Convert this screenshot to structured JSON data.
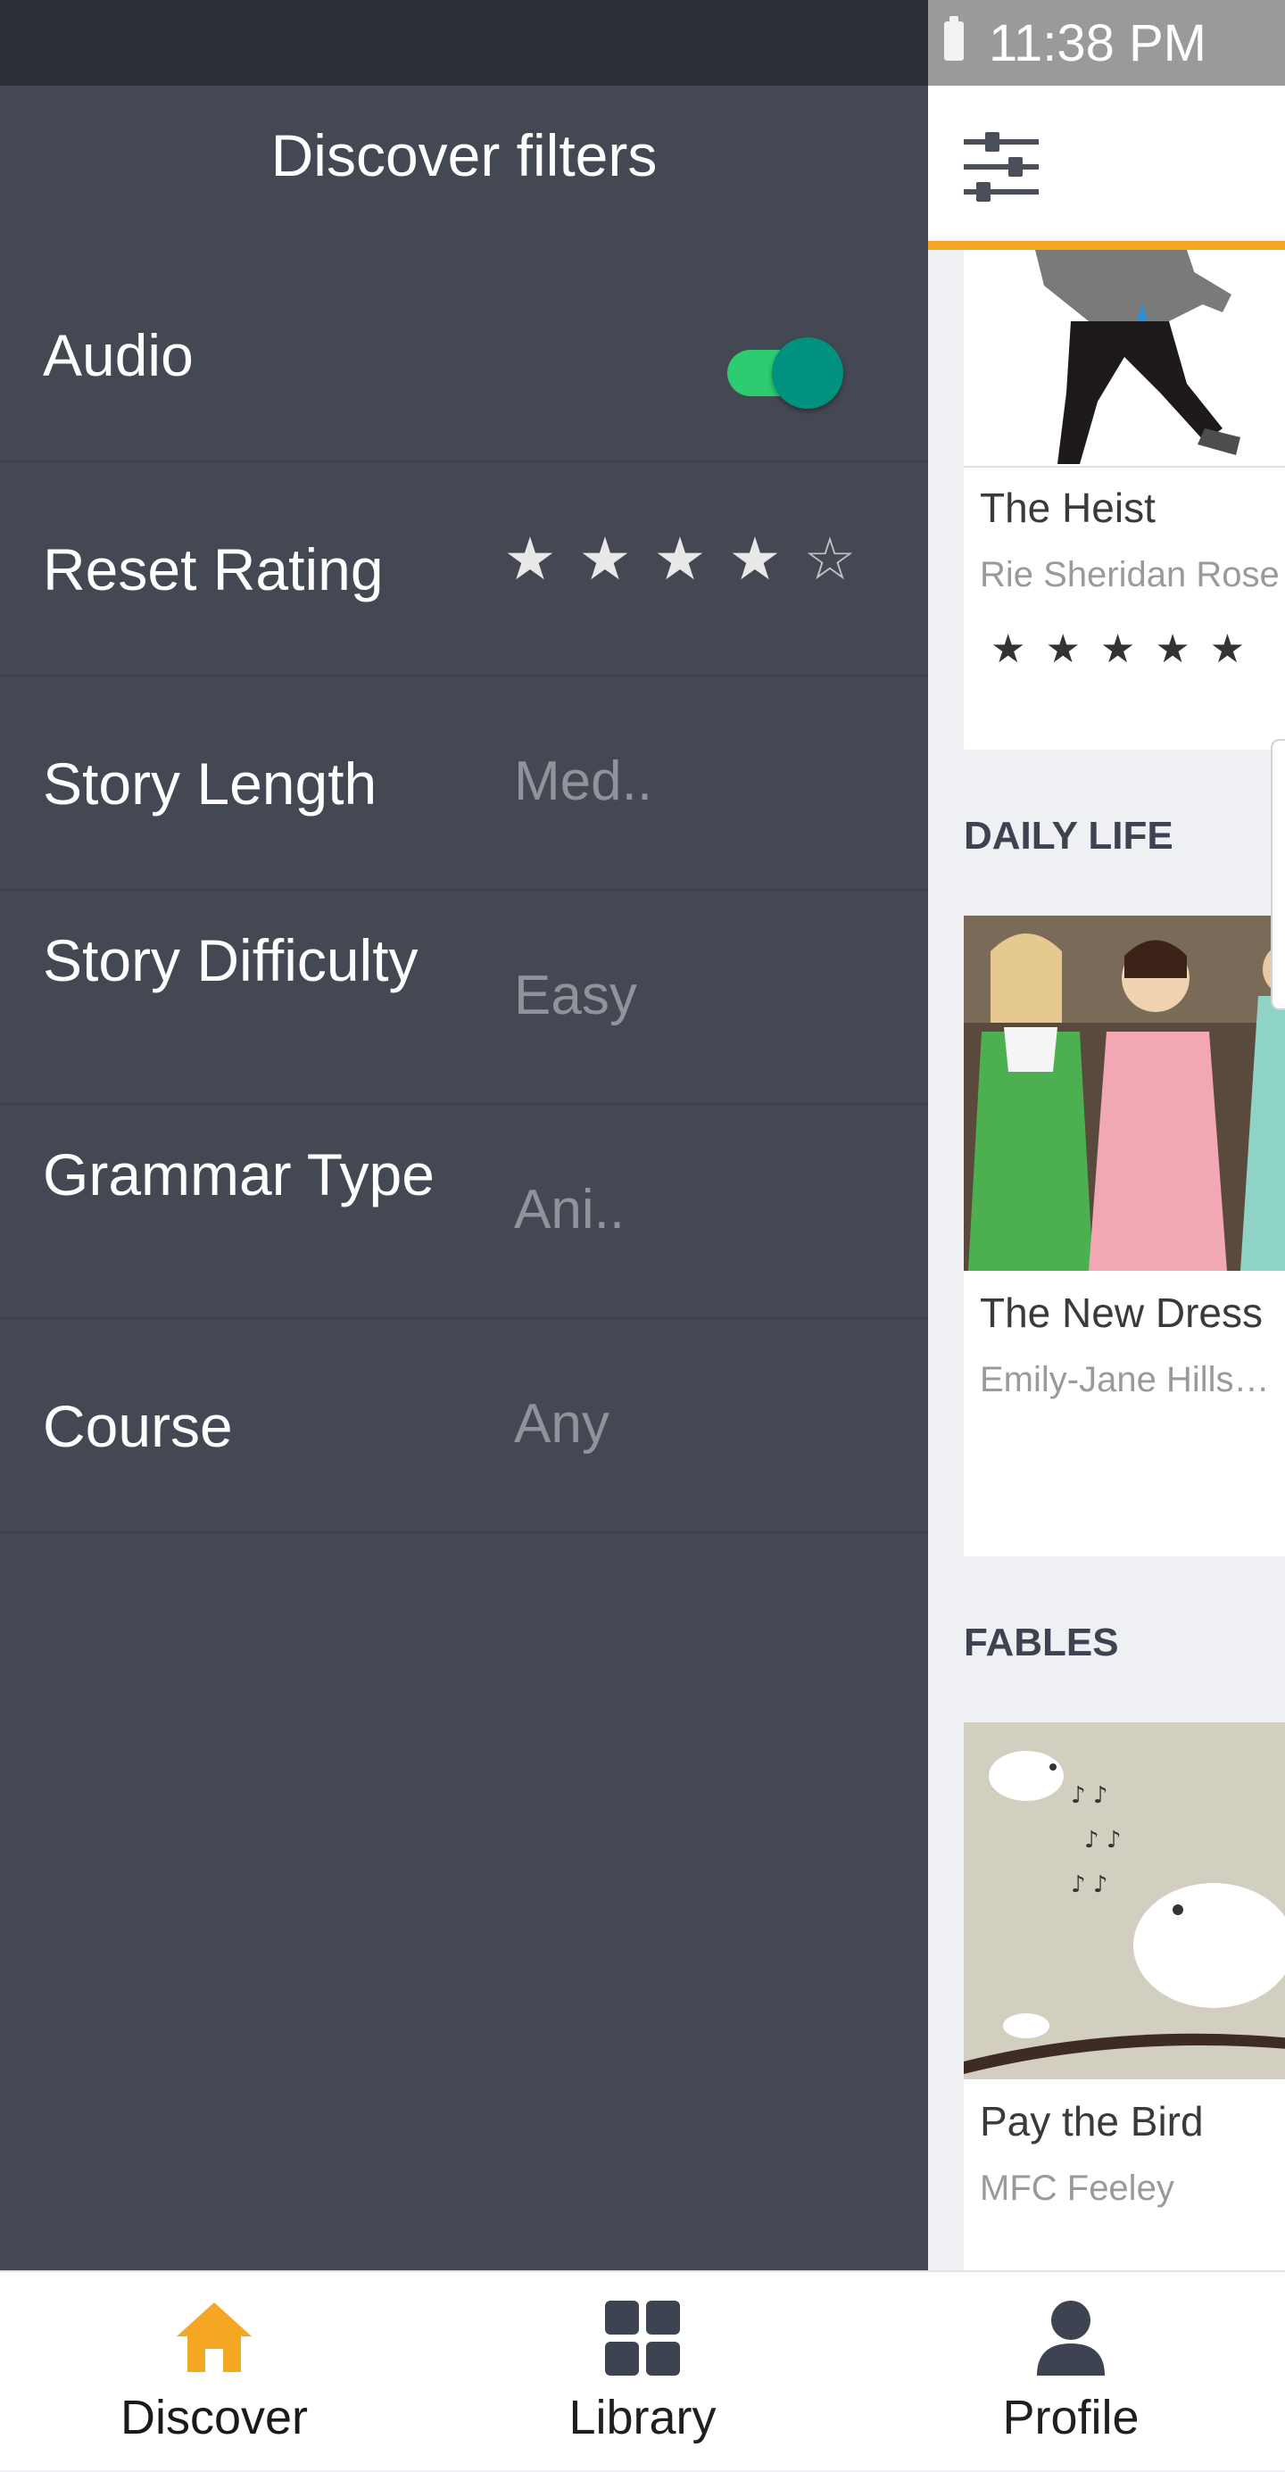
{
  "status_bar": {
    "time": "11:38 PM"
  },
  "drawer": {
    "title": "Discover filters",
    "filters": [
      {
        "label": "Audio",
        "control": "toggle",
        "enabled": true
      },
      {
        "label": "Reset Rating",
        "control": "stars",
        "rating": 4,
        "max": 5
      },
      {
        "label": "Story Length",
        "value": "Med.."
      },
      {
        "label": "Story Difficulty",
        "value": "Easy"
      },
      {
        "label": "Grammar Type",
        "value": "Ani.."
      },
      {
        "label": "Course",
        "value": "Any"
      }
    ]
  },
  "main": {
    "top_bar": {
      "filter_icon": "sliders-icon"
    },
    "sections": [
      {
        "title": "",
        "stories": [
          {
            "title": "The Heist",
            "author": "Rie Sheridan Rose",
            "stars": 5
          }
        ]
      },
      {
        "title": "DAILY LIFE",
        "stories": [
          {
            "title": "The New Dress",
            "author": "Emily-Jane Hills…"
          }
        ]
      },
      {
        "title": "FABLES",
        "stories": [
          {
            "title": "Pay the Bird",
            "author": "MFC Feeley"
          }
        ]
      }
    ]
  },
  "bottom_nav": {
    "items": [
      {
        "label": "Discover",
        "icon": "home-icon",
        "active": true
      },
      {
        "label": "Library",
        "icon": "grid-icon",
        "active": false
      },
      {
        "label": "Profile",
        "icon": "person-icon",
        "active": false
      }
    ]
  },
  "colors": {
    "drawer_bg": "#444852",
    "accent": "#f5a623",
    "toggle_on": "#2ecc71",
    "toggle_knob": "#00927f"
  }
}
